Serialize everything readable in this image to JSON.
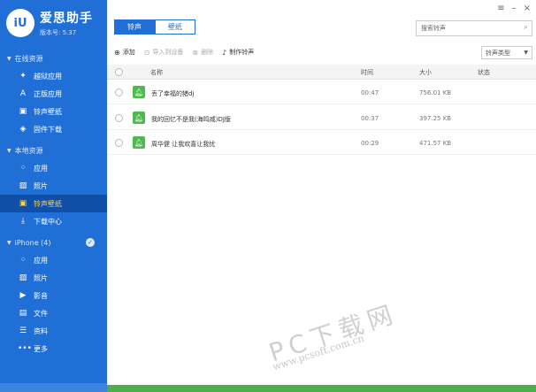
{
  "app": {
    "logo": "iU",
    "name": "爱思助手",
    "version": "版本号: 5.37"
  },
  "sidebar": {
    "groups": [
      {
        "title": "在线资源",
        "items": [
          {
            "label": "越狱应用",
            "icon": "puzzle-icon",
            "glyph": "✦"
          },
          {
            "label": "正版应用",
            "icon": "app-store-icon",
            "glyph": "A"
          },
          {
            "label": "铃声壁纸",
            "icon": "ringtone-wallpaper-icon",
            "glyph": "▣"
          },
          {
            "label": "固件下载",
            "icon": "firmware-icon",
            "glyph": "◈"
          }
        ]
      },
      {
        "title": "本地资源",
        "items": [
          {
            "label": "应用",
            "icon": "apps-grid-icon",
            "glyph": "⁘"
          },
          {
            "label": "照片",
            "icon": "photo-icon",
            "glyph": "▨"
          },
          {
            "label": "铃声壁纸",
            "icon": "ringtone-wallpaper-icon",
            "glyph": "▣",
            "active": true
          },
          {
            "label": "下载中心",
            "icon": "download-icon",
            "glyph": "⤓"
          }
        ]
      },
      {
        "title": "iPhone (4)",
        "items": [
          {
            "label": "应用",
            "icon": "apps-grid-icon",
            "glyph": "⁘"
          },
          {
            "label": "照片",
            "icon": "photo-icon",
            "glyph": "▨"
          },
          {
            "label": "影音",
            "icon": "media-icon",
            "glyph": "▶"
          },
          {
            "label": "文件",
            "icon": "file-icon",
            "glyph": "▤"
          },
          {
            "label": "资料",
            "icon": "contacts-icon",
            "glyph": "☰"
          },
          {
            "label": "更多",
            "icon": "more-icon",
            "glyph": "•••"
          }
        ]
      }
    ]
  },
  "tabs": [
    {
      "label": "铃声",
      "active": true
    },
    {
      "label": "壁纸",
      "active": false
    }
  ],
  "window_controls": {
    "menu": "≡",
    "minimize": "–",
    "close": "×"
  },
  "search": {
    "placeholder": "搜索铃声"
  },
  "toolbar": {
    "add": "添加",
    "import": "导入到设备",
    "delete": "删除",
    "make": "制作铃声"
  },
  "type_select": {
    "value": "铃声类型"
  },
  "table": {
    "headers": {
      "name": "名称",
      "time": "时间",
      "size": "大小",
      "status": "状态"
    },
    "rows": [
      {
        "name": "丢了幸福的猪dj",
        "time": "00:47",
        "size": "756.01 KB"
      },
      {
        "name": "我的回忆不是我(海鸣威)DJ版",
        "time": "00:37",
        "size": "397.25 KB"
      },
      {
        "name": "周华健 让我欢喜让我忧",
        "time": "00:29",
        "size": "471.57 KB"
      }
    ]
  },
  "watermark": {
    "brand": "PC下载网",
    "url": "www.pcsoft.com.cn"
  }
}
